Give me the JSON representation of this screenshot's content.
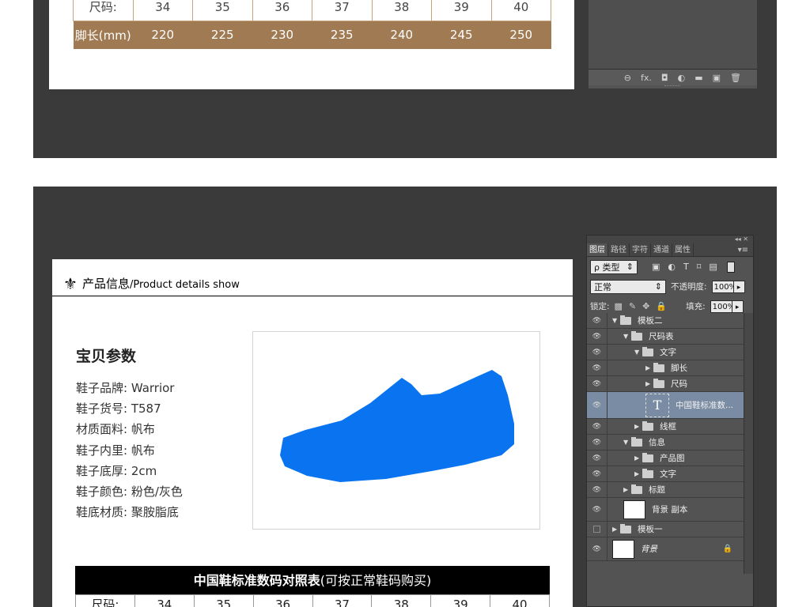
{
  "top_size_table": {
    "rows": [
      {
        "label": "尺码:",
        "values": [
          "34",
          "35",
          "36",
          "37",
          "38",
          "39",
          "40"
        ]
      },
      {
        "label": "脚长(mm)",
        "values": [
          "220",
          "225",
          "230",
          "235",
          "240",
          "245",
          "250"
        ]
      }
    ]
  },
  "section": {
    "icon": "fleur-de-lis-icon",
    "icon_glyph": "⚜",
    "title_zh": "产品信息",
    "title_en": "/Product details show"
  },
  "params": {
    "title": "宝贝参数",
    "items": [
      "鞋子品牌: Warrior",
      "鞋子货号: T587",
      "材质面料: 帆布",
      "鞋子内里: 帆布",
      "鞋子底厚: 2cm",
      "鞋子颜色: 粉色/灰色",
      "鞋底材质: 聚胺脂底"
    ]
  },
  "product_image": {
    "fill_color": "#0a74f0"
  },
  "size_chart_bar": {
    "bold": "中国鞋标准数码对照表",
    "normal": "(可按正常鞋码购买)"
  },
  "bottom_size_table": {
    "label": "尺码:",
    "values": [
      "34",
      "35",
      "36",
      "37",
      "38",
      "39",
      "40"
    ]
  },
  "top_panel_footer": {
    "icons": [
      "link-icon",
      "fx-icon",
      "mask-icon",
      "adjustment-icon",
      "folder-icon",
      "new-layer-icon",
      "trash-icon"
    ],
    "glyphs": [
      "⊖",
      "fx.",
      "◘",
      "◐",
      "▬",
      "▣",
      "🗑"
    ]
  },
  "layers_panel": {
    "collapse_glyph": "◂◂ ✕",
    "tabs": [
      "图层",
      "路径",
      "字符",
      "通道",
      "属性"
    ],
    "menu_glyph": "▾≡",
    "filter": {
      "label": "ρ 类型",
      "arrow": "⇕",
      "icons": [
        "▣",
        "◐",
        "T",
        "⌑",
        "▤"
      ]
    },
    "blend_mode": {
      "value": "正常",
      "arrow": "⇕"
    },
    "opacity": {
      "label": "不透明度:",
      "value": "100%",
      "arrow": "▸"
    },
    "lock": {
      "label": "锁定:",
      "icons": [
        "▩",
        "✎",
        "✥",
        "🔒"
      ]
    },
    "fill": {
      "label": "填充:",
      "value": "100%",
      "arrow": "▸"
    },
    "layers": [
      {
        "name": "模板二",
        "type": "folder",
        "indent": 0,
        "expanded": true,
        "visible": true
      },
      {
        "name": "尺码表",
        "type": "folder",
        "indent": 1,
        "expanded": true,
        "visible": true
      },
      {
        "name": "文字",
        "type": "folder",
        "indent": 2,
        "expanded": true,
        "visible": true
      },
      {
        "name": "脚长",
        "type": "folder",
        "indent": 3,
        "expanded": false,
        "visible": true
      },
      {
        "name": "尺码",
        "type": "folder",
        "indent": 3,
        "expanded": false,
        "visible": true
      },
      {
        "name": "中国鞋标准数...",
        "type": "text",
        "indent": 3,
        "selected": true,
        "visible": true,
        "glyph": "T"
      },
      {
        "name": "线框",
        "type": "folder",
        "indent": 2,
        "expanded": false,
        "visible": true
      },
      {
        "name": "信息",
        "type": "folder",
        "indent": 1,
        "expanded": true,
        "visible": true
      },
      {
        "name": "产品图",
        "type": "folder",
        "indent": 2,
        "expanded": false,
        "visible": true
      },
      {
        "name": "文字",
        "type": "folder",
        "indent": 2,
        "expanded": false,
        "visible": true
      },
      {
        "name": "标题",
        "type": "folder",
        "indent": 1,
        "expanded": false,
        "visible": true
      },
      {
        "name": "背景 副本",
        "type": "pixel",
        "indent": 1,
        "visible": true
      },
      {
        "name": "模板一",
        "type": "folder",
        "indent": 0,
        "expanded": false,
        "visible": false
      },
      {
        "name": "背景",
        "type": "pixel",
        "indent": 0,
        "visible": true,
        "locked": true,
        "italic": true,
        "lock_glyph": "🔒"
      }
    ]
  },
  "colors": {
    "workspace": "#3a3a3a",
    "panel": "#535353",
    "table_brown": "#a07a52",
    "table_border": "#caa27a",
    "selection": "#7a8ca3"
  }
}
